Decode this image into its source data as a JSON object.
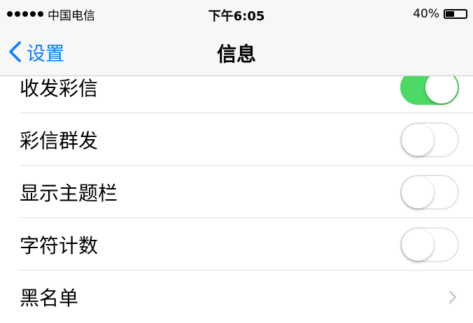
{
  "status_bar": {
    "carrier": "中国电信",
    "time": "下午6:05",
    "battery_percent": "40%",
    "battery_level": 0.4
  },
  "nav": {
    "back_label": "设置",
    "title": "信息",
    "accent_color": "#0a7aff"
  },
  "settings": {
    "items": [
      {
        "label": "收发彩信",
        "type": "toggle",
        "on": true
      },
      {
        "label": "彩信群发",
        "type": "toggle",
        "on": false
      },
      {
        "label": "显示主题栏",
        "type": "toggle",
        "on": false
      },
      {
        "label": "字符计数",
        "type": "toggle",
        "on": false
      },
      {
        "label": "黑名单",
        "type": "disclosure"
      }
    ],
    "toggle_on_color": "#4cd964"
  },
  "icons": {
    "back": "chevron-left-icon",
    "disclosure": "chevron-right-icon",
    "signal": "signal-dots-icon",
    "battery": "battery-icon"
  }
}
